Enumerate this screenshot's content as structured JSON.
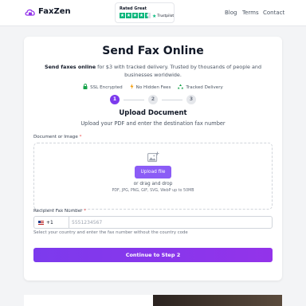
{
  "brand": {
    "name": "FaxZen",
    "logo_icon": "fax-cloud-icon",
    "accent": "#9333ea"
  },
  "trustpilot": {
    "rated": "Rated Great",
    "brand": "Trustpilot",
    "stars": 4.5,
    "star_color": "#00b67a"
  },
  "nav": {
    "blog": "Blog",
    "terms": "Terms",
    "contact": "Contact"
  },
  "hero": {
    "title": "Send Fax Online",
    "subtitle_bold": "Send faxes online",
    "subtitle_rest": " for $3 with tracked delivery. Trusted by thousands of people and businesses worldwide."
  },
  "features": [
    {
      "icon": "lock-icon",
      "label": "SSL Encrypted"
    },
    {
      "icon": "lightning-icon",
      "label": "No Hidden Fees"
    },
    {
      "icon": "recycle-icon",
      "label": "Tracked Delivery"
    }
  ],
  "steps": {
    "one": "1",
    "two": "2",
    "three": "3",
    "current": 1
  },
  "upload": {
    "title": "Upload Document",
    "subtitle": "Upload your PDF and enter the destination fax number",
    "field_label": "Document or Image",
    "required_mark": "*",
    "button": "Upload file",
    "or_text": "or drag and drop",
    "types": "PDF, JPG, PNG, GIF, SVG, WebP up to 50MB"
  },
  "fax": {
    "label": "Recipient Fax Number",
    "required_mark": "*",
    "country_code": "+1",
    "placeholder": "5551234567",
    "help": "Select your country and enter the fax number without the country code"
  },
  "cta": {
    "continue": "Continue to Step 2"
  }
}
